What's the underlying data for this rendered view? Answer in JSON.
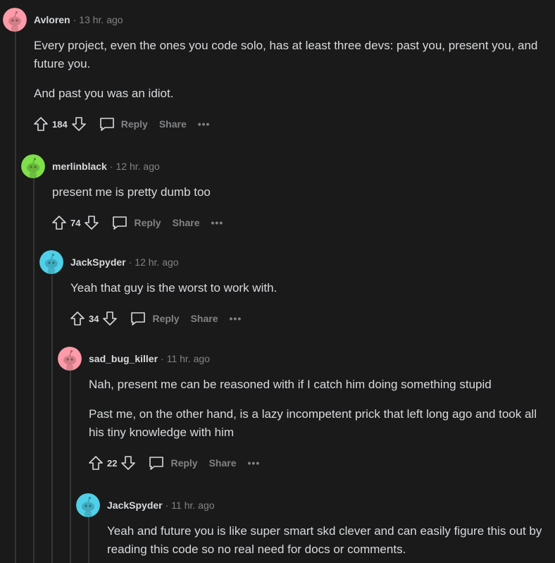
{
  "comments": [
    {
      "author": "Avloren",
      "time": "13 hr. ago",
      "avatar_color": "#ff9aa8",
      "paragraphs": [
        "Every project, even the ones you code solo, has at least three devs: past you, present you, and future you.",
        "And past you was an idiot."
      ],
      "score": "184",
      "reply_label": "Reply",
      "share_label": "Share",
      "more_label": "•••"
    },
    {
      "author": "merlinblack",
      "time": "12 hr. ago",
      "avatar_color": "#7fe04a",
      "paragraphs": [
        "present me is pretty dumb too"
      ],
      "score": "74",
      "reply_label": "Reply",
      "share_label": "Share",
      "more_label": "•••"
    },
    {
      "author": "JackSpyder",
      "time": "12 hr. ago",
      "avatar_color": "#4fd0e8",
      "paragraphs": [
        "Yeah that guy is the worst to work with."
      ],
      "score": "34",
      "reply_label": "Reply",
      "share_label": "Share",
      "more_label": "•••"
    },
    {
      "author": "sad_bug_killer",
      "time": "11 hr. ago",
      "avatar_color": "#ff9aa8",
      "paragraphs": [
        "Nah, present me can be reasoned with if I catch him doing something stupid",
        "Past me, on the other hand, is a lazy incompetent prick that left long ago and took all his tiny knowledge with him"
      ],
      "score": "22",
      "reply_label": "Reply",
      "share_label": "Share",
      "more_label": "•••"
    },
    {
      "author": "JackSpyder",
      "time": "11 hr. ago",
      "avatar_color": "#4fd0e8",
      "paragraphs": [
        "Yeah and future you is like super smart skd clever and can easily figure this out by reading this code so no real need for docs or comments."
      ]
    }
  ],
  "icons": {
    "upvote": "upvote-icon",
    "downvote": "downvote-icon",
    "comment": "comment-bubble-icon",
    "avatar": "snoo-avatar-icon"
  }
}
